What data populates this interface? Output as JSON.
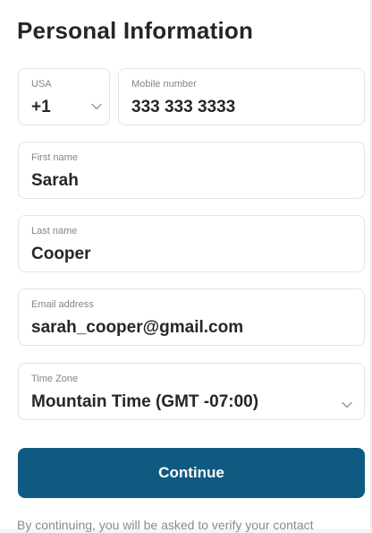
{
  "page": {
    "title": "Personal Information"
  },
  "form": {
    "country_code": {
      "label": "USA",
      "value": "+1"
    },
    "mobile_number": {
      "label": "Mobile number",
      "value": "333 333 3333"
    },
    "first_name": {
      "label": "First name",
      "value": "Sarah"
    },
    "last_name": {
      "label": "Last name",
      "value": "Cooper"
    },
    "email": {
      "label": "Email address",
      "value": "sarah_cooper@gmail.com"
    },
    "time_zone": {
      "label": "Time Zone",
      "value": "Mountain Time (GMT -07:00)"
    }
  },
  "actions": {
    "continue_label": "Continue"
  },
  "footer": {
    "note": "By continuing, you will be asked to verify your contact"
  },
  "colors": {
    "primary_button": "#0f5a80",
    "text_primary": "#262626",
    "text_muted": "#858585",
    "field_border": "#e4e4e4"
  },
  "icons": {
    "dropdown": "chevron-down-icon"
  }
}
